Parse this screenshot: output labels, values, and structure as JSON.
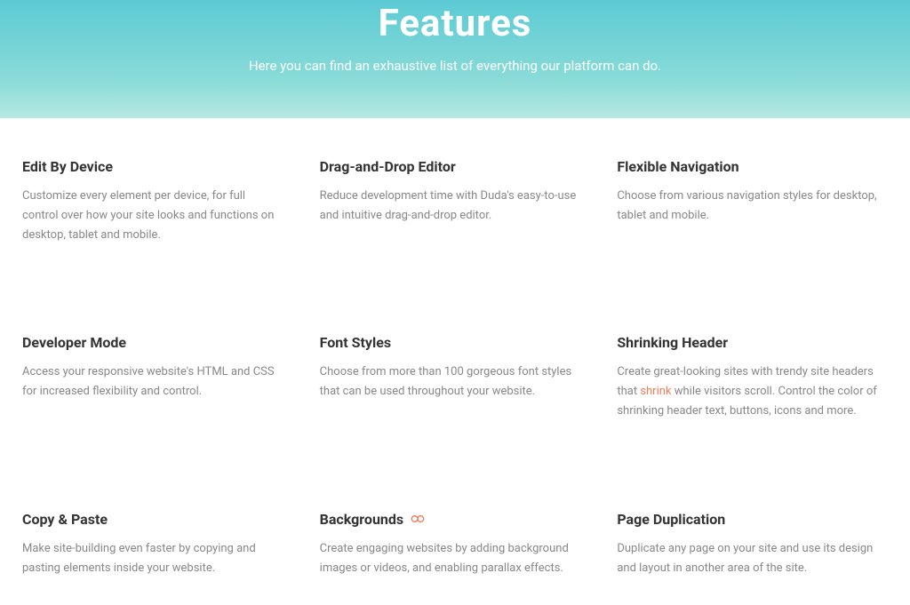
{
  "hero": {
    "title": "Features",
    "subtitle": "Here you can find an exhaustive list of everything our platform can do."
  },
  "features": [
    {
      "title": "Edit By Device",
      "description": "Customize every element per device, for full control over how your site looks and functions on desktop, tablet and mobile."
    },
    {
      "title": "Drag-and-Drop Editor",
      "description": "Reduce development time with Duda's easy-to-use and intuitive drag-and-drop editor."
    },
    {
      "title": "Flexible Navigation",
      "description": "Choose from various navigation styles for desktop, tablet and mobile."
    },
    {
      "title": "Developer Mode",
      "description": "Access your responsive website's HTML and CSS for increased flexibility and control."
    },
    {
      "title": "Font Styles",
      "description": "Choose from more than 100 gorgeous font styles that can be used throughout your website."
    },
    {
      "title": "Shrinking Header",
      "desc_before": "Create great-looking sites with trendy site headers that ",
      "desc_link": "shrink",
      "desc_after": " while visitors scroll. Control the color of shrinking header text, buttons, icons and more."
    },
    {
      "title": "Copy & Paste",
      "description": "Make site-building even faster by copying and pasting elements inside your website."
    },
    {
      "title": "Backgrounds",
      "has_icon": true,
      "description": "Create engaging websites by adding background images or videos, and enabling parallax effects."
    },
    {
      "title": "Page Duplication",
      "description": "Duplicate any page on your site and use its design and layout in another area of the site."
    }
  ]
}
